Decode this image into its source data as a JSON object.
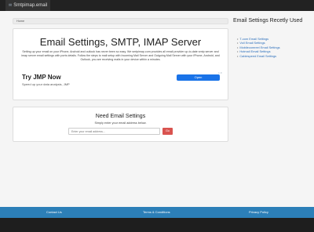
{
  "navbar": {
    "brand": "Smtpimap.email",
    "brand_icon": "envelope-icon"
  },
  "breadcrumb": {
    "home": "Home"
  },
  "hero": {
    "title": "Email Settings, SMTP, IMAP Server",
    "description": "Setting up your email on your iPhone, Android and outlook has never been so easy. We smtpimap.com provides all email provider up-to-date smtp server and imap server email settings with ports details. Follow the steps to mail setup with Incoming Mail Server and Outgoing Mail Server with your iPhone, Android, and Outlook, you are receiving mails in your device within a minutes."
  },
  "ad": {
    "title": "Try JMP Now",
    "subtitle": "Speed up your data analysis, JMP",
    "button": "Open"
  },
  "newsletter": {
    "title": "Need Email Settings",
    "subtitle": "Simply enter your email address below.",
    "placeholder": "Enter your email address...",
    "button": "Go"
  },
  "sidebar": {
    "title": "Email Settings Recetly Used",
    "items": [
      "T-com Email Settings",
      "Voil Email Settings",
      "Mobilecomreel Email Settings",
      "Hotmail Email Settings",
      "Cablespeed Email Settings"
    ]
  },
  "footer": {
    "links": [
      "Contact Us",
      "Terms & Conditions",
      "Privacy Policy"
    ],
    "color": "#2c7fb8"
  }
}
